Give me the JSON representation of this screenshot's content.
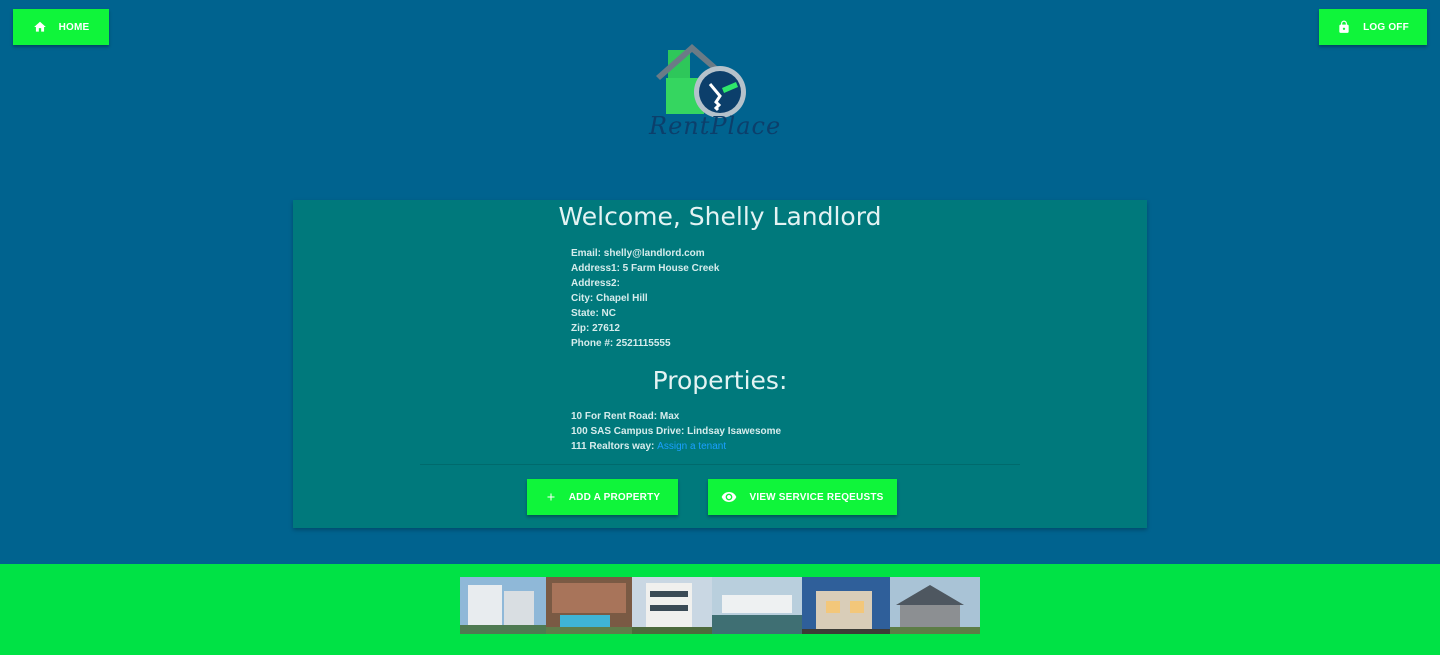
{
  "nav": {
    "home_label": "HOME",
    "logoff_label": "LOG OFF"
  },
  "logo": {
    "text": "RentPlace"
  },
  "profile": {
    "welcome": "Welcome, Shelly Landlord",
    "email": "Email: shelly@landlord.com",
    "address1": "Address1: 5 Farm House Creek",
    "address2": "Address2:",
    "city": "City: Chapel Hill",
    "state": "State: NC",
    "zip": "Zip: 27612",
    "phone": "Phone #: 2521115555"
  },
  "properties": {
    "title": "Properties:",
    "items": [
      {
        "text": "10 For Rent Road: Max"
      },
      {
        "text": "100 SAS Campus Drive: Lindsay Isawesome"
      },
      {
        "text": "111 Realtors way:",
        "link": "Assign a tenant"
      }
    ]
  },
  "actions": {
    "add_label": "ADD A PROPERTY",
    "view_label": "VIEW SERVICE REQEUSTS"
  },
  "icons": {
    "home": "home-icon",
    "logoff": "lock-icon",
    "add": "plus-icon",
    "view": "eye-icon"
  },
  "colors": {
    "background": "#00638f",
    "card": "#00797c",
    "accent": "#0ff53a",
    "footer": "#00e245",
    "link": "#1aa0ff"
  }
}
